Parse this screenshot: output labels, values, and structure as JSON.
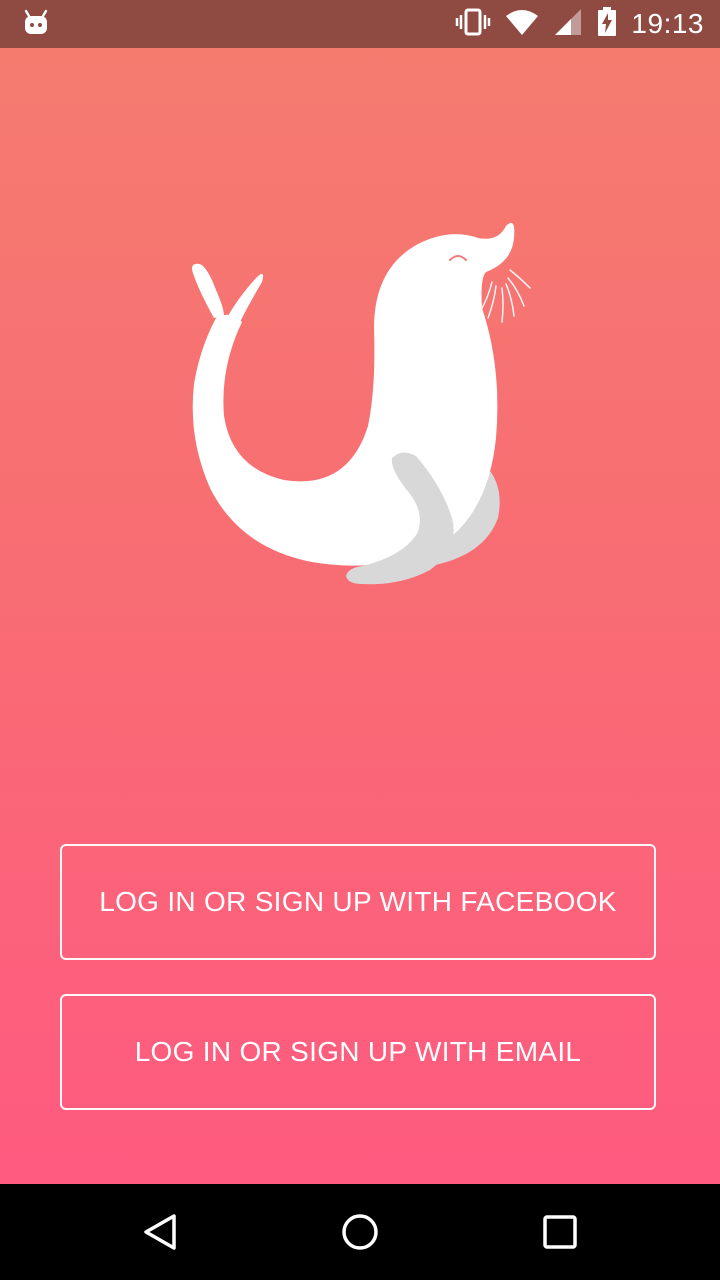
{
  "status_bar": {
    "time": "19:13",
    "icons": [
      "android-notification-icon",
      "vibrate-icon",
      "wifi-icon",
      "signal-icon",
      "battery-charging-icon"
    ]
  },
  "mascot": {
    "icon": "seal-mascot-icon"
  },
  "buttons": {
    "facebook": "LOG IN OR SIGN UP WITH FACEBOOK",
    "email": "LOG IN OR SIGN UP WITH EMAIL"
  },
  "nav_bar": {
    "icons": [
      "back-icon",
      "home-icon",
      "recent-apps-icon"
    ]
  },
  "colors": {
    "status_bar": "#8f4a42",
    "gradient_top": "#f57b6f",
    "gradient_bottom": "#ff5a80",
    "button_border": "#ffffff"
  }
}
